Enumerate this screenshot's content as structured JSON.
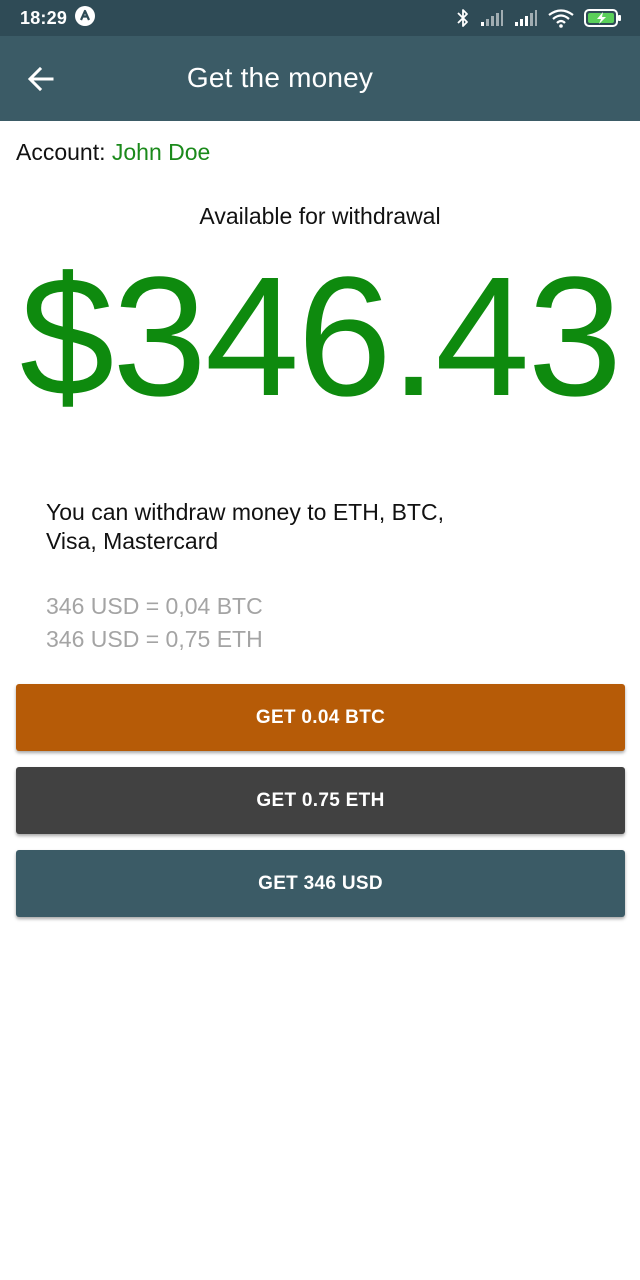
{
  "status_bar": {
    "time": "18:29",
    "icons": [
      "notification-a-icon",
      "bluetooth-icon",
      "signal-icon",
      "signal-icon",
      "wifi-icon",
      "battery-charging-icon"
    ]
  },
  "app_bar": {
    "title": "Get the money",
    "back_icon": "arrow-left-icon"
  },
  "account": {
    "label": "Account: ",
    "name": "John Doe"
  },
  "balance": {
    "label": "Available for withdrawal",
    "amount": "$346.43"
  },
  "info": {
    "text": "You can withdraw money to ETH, BTC, Visa, Mastercard"
  },
  "rates": {
    "btc": "346 USD = 0,04 BTC",
    "eth": "346 USD = 0,75 ETH"
  },
  "buttons": {
    "btc": "GET 0.04 BTC",
    "eth": "GET 0.75 ETH",
    "usd": "GET 346 USD"
  },
  "colors": {
    "status_bar": "#2f4b56",
    "app_bar": "#3b5b66",
    "accent_green": "#0e8a0e",
    "btc_button": "#b65b07",
    "eth_button": "#414141",
    "usd_button": "#3b5b66",
    "muted_text": "#a4a4a4"
  }
}
